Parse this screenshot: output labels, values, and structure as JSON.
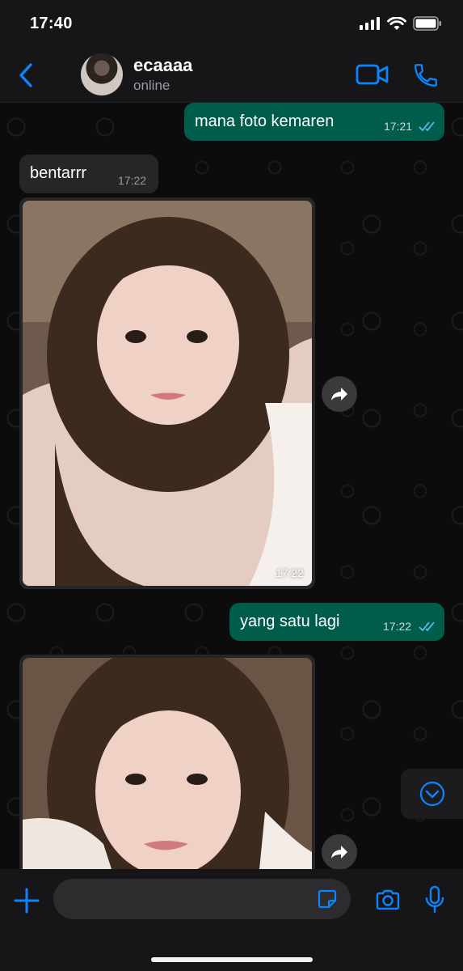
{
  "status_bar": {
    "time": "17:40"
  },
  "header": {
    "name": "ecaaaa",
    "status": "online"
  },
  "messages": {
    "m1": {
      "text": "mana foto kemaren",
      "time": "17:21"
    },
    "m2": {
      "text": "bentarrr",
      "time": "17:22"
    },
    "m3": {
      "time": "17:22"
    },
    "m4": {
      "text": "yang satu lagi",
      "time": "17:22"
    }
  },
  "colors": {
    "accent": "#0a84ff",
    "outgoing_bubble": "#005c4b",
    "incoming_bubble": "#262628",
    "read_ticks": "#53bdeb"
  },
  "icons": [
    "back-chevron-icon",
    "video-call-icon",
    "phone-icon",
    "forward-icon",
    "chevron-down-icon",
    "plus-icon",
    "sticker-icon",
    "camera-icon",
    "microphone-icon"
  ]
}
